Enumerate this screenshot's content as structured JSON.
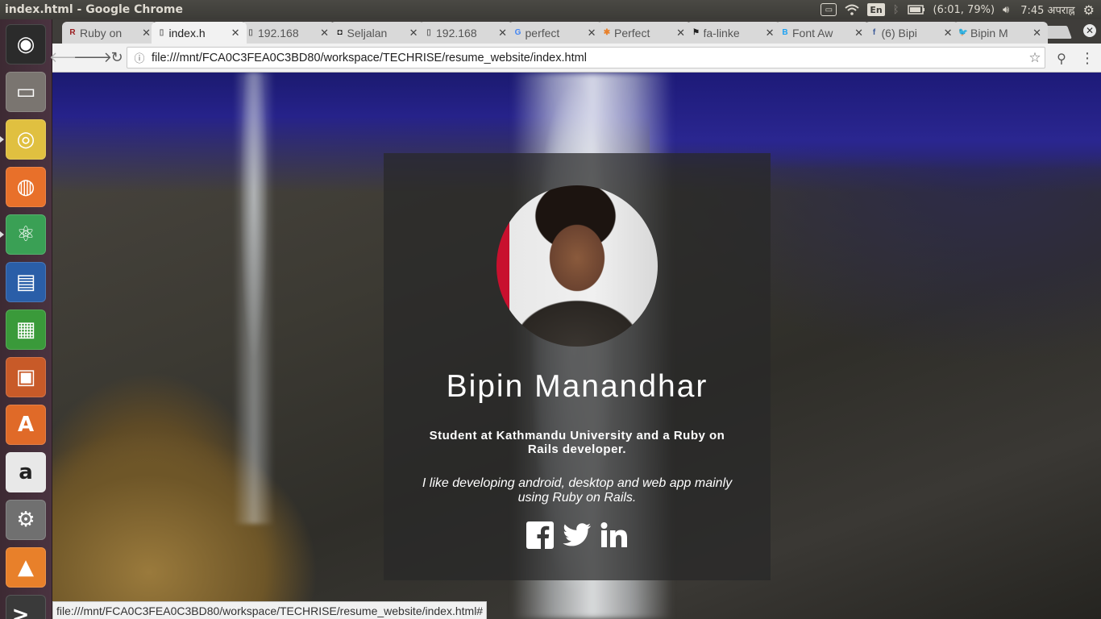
{
  "top_panel": {
    "window_title": "index.html - Google Chrome",
    "keyboard_layout": "En",
    "battery": "(6:01, 79%)",
    "clock": "7:45 अपराह्न"
  },
  "launcher": {
    "items": [
      {
        "name": "ubuntu-dash-icon",
        "glyph": "◉",
        "color": "#2b2b2b"
      },
      {
        "name": "files-icon",
        "glyph": "▭",
        "color": "#7a7570"
      },
      {
        "name": "chrome-icon",
        "glyph": "◎",
        "color": "#e0c040"
      },
      {
        "name": "firefox-icon",
        "glyph": "◍",
        "color": "#e8702a"
      },
      {
        "name": "atom-icon",
        "glyph": "⚛",
        "color": "#3aa055"
      },
      {
        "name": "writer-icon",
        "glyph": "▤",
        "color": "#2a5ea8"
      },
      {
        "name": "calc-icon",
        "glyph": "▦",
        "color": "#3a9a3a"
      },
      {
        "name": "impress-icon",
        "glyph": "▣",
        "color": "#c85a28"
      },
      {
        "name": "software-center-icon",
        "glyph": "A",
        "color": "#e06a28"
      },
      {
        "name": "amazon-icon",
        "glyph": "a",
        "color": "#e8e8e8"
      },
      {
        "name": "system-settings-icon",
        "glyph": "⚙",
        "color": "#707070"
      },
      {
        "name": "vlc-icon",
        "glyph": "▲",
        "color": "#e8802a"
      },
      {
        "name": "terminal-icon",
        "glyph": ">_",
        "color": "#3a3a3a"
      }
    ]
  },
  "tabs": [
    {
      "title": "Ruby on",
      "fav": "R",
      "fav_color": "#9b1d20",
      "active": false
    },
    {
      "title": "index.h",
      "fav": "▯",
      "fav_color": "#666666",
      "active": true
    },
    {
      "title": "192.168",
      "fav": "▯",
      "fav_color": "#666666",
      "active": false
    },
    {
      "title": "Seljalan",
      "fav": "◘",
      "fav_color": "#000000",
      "active": false
    },
    {
      "title": "192.168",
      "fav": "▯",
      "fav_color": "#666666",
      "active": false
    },
    {
      "title": "perfect",
      "fav": "G",
      "fav_color": "#4285f4",
      "active": false
    },
    {
      "title": "Perfect",
      "fav": "✱",
      "fav_color": "#e8802a",
      "active": false
    },
    {
      "title": "fa-linke",
      "fav": "⚑",
      "fav_color": "#222222",
      "active": false
    },
    {
      "title": "Font Aw",
      "fav": "B",
      "fav_color": "#1da1f2",
      "active": false
    },
    {
      "title": "(6) Bipi",
      "fav": "f",
      "fav_color": "#3b5998",
      "active": false
    },
    {
      "title": "Bipin M",
      "fav": "🐦",
      "fav_color": "#1da1f2",
      "active": false
    }
  ],
  "toolbar": {
    "url": "file:///mnt/FCA0C3FEA0C3BD80/workspace/TECHRISE/resume_website/index.html"
  },
  "page": {
    "name": "Bipin Manandhar",
    "headline": "Student at Kathmandu University and a Ruby on Rails developer.",
    "bio": "I like developing android, desktop and web app mainly using Ruby on Rails.",
    "social": [
      "facebook-icon",
      "twitter-icon",
      "linkedin-icon"
    ]
  },
  "status_bar": {
    "link": "file:///mnt/FCA0C3FEA0C3BD80/workspace/TECHRISE/resume_website/index.html#"
  }
}
